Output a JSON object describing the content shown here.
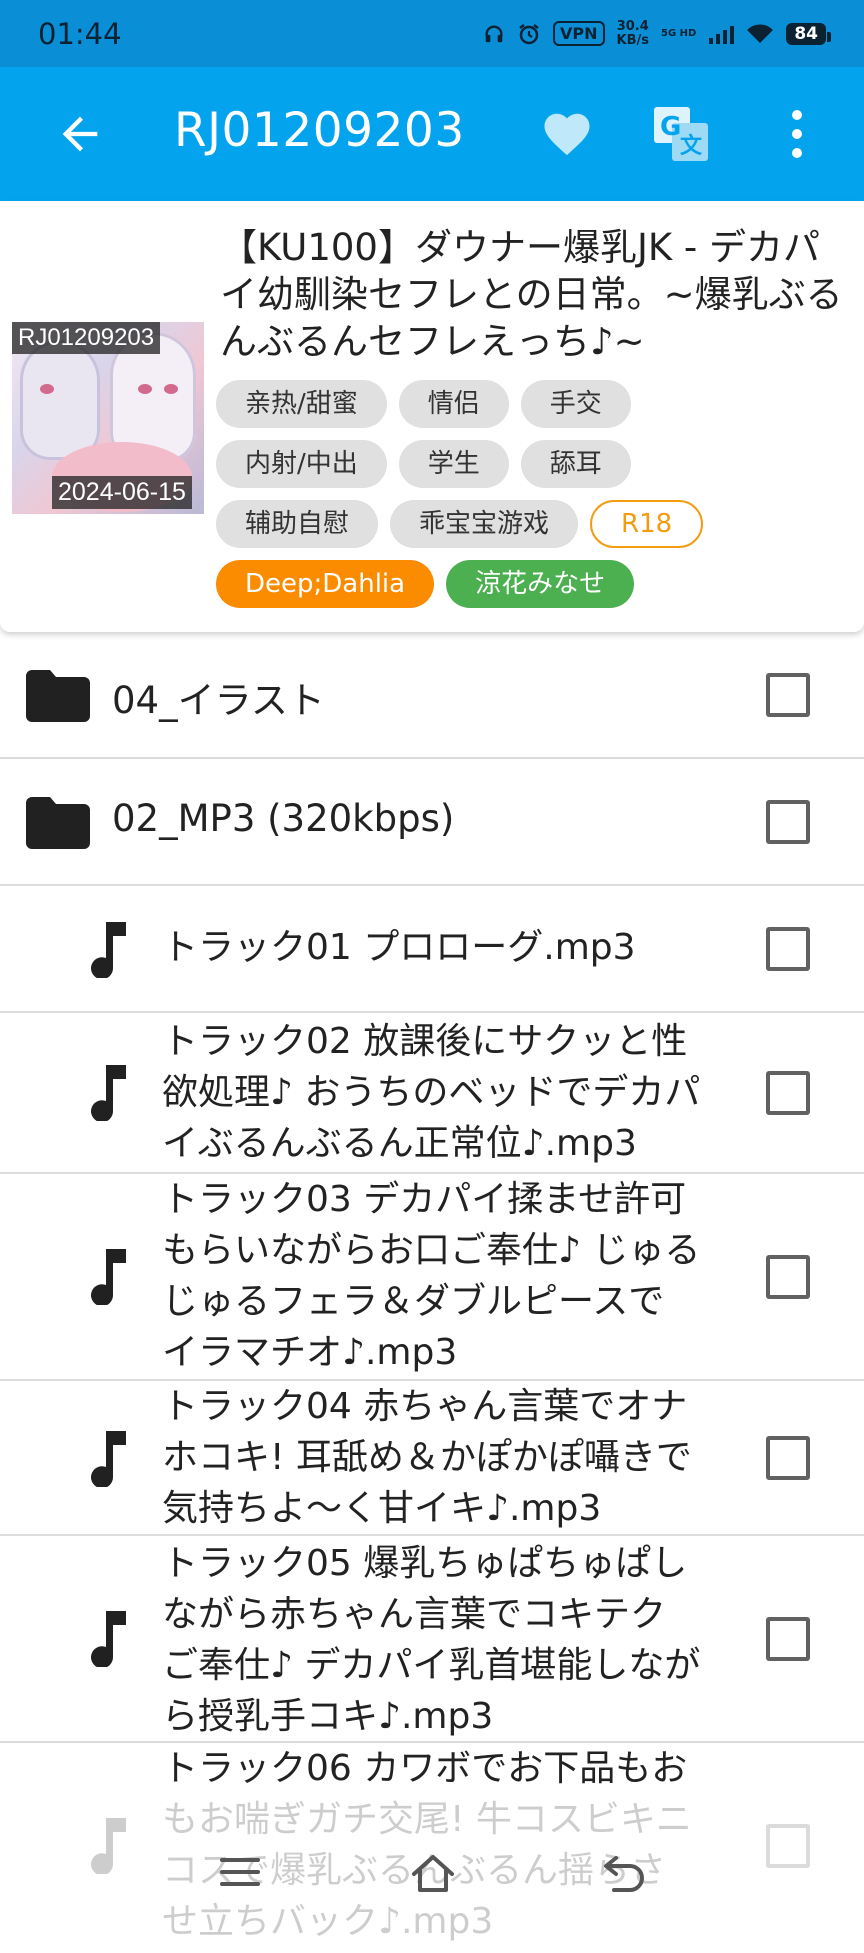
{
  "status_bar": {
    "time": "01:44",
    "vpn": "VPN",
    "net_speed_value": "30.4",
    "net_speed_unit": "KB/s",
    "network": "5G HD",
    "battery": "84"
  },
  "app_bar": {
    "title": "RJ01209203",
    "icons": [
      "back-arrow-icon",
      "heart-icon",
      "translate-icon",
      "more-vert-icon"
    ]
  },
  "work": {
    "cover_id": "RJ01209203",
    "release_date": "2024-06-15",
    "title": "【KU100】ダウナー爆乳JK - デカパイ幼馴染セフレとの日常。~爆乳ぶるんぶるんセフレえっち♪~",
    "tag_rows": [
      [
        "亲热/甜蜜",
        "情侣",
        "手交"
      ],
      [
        "内射/中出",
        "学生",
        "舔耳"
      ],
      [
        "辅助自慰",
        "乖宝宝游戏"
      ]
    ],
    "age_rating": "R18",
    "circle": "Deep;Dahlia",
    "voice_actor": "涼花みなせ",
    "colors": {
      "circle": "#fb8c00",
      "voice_actor": "#4caf50",
      "r18": "#f39c12",
      "app_bar": "#03a4ed"
    }
  },
  "files": {
    "folders": [
      {
        "name": "04_イラスト",
        "icon": "folder-icon"
      },
      {
        "name": "02_MP3 (320kbps)",
        "icon": "folder-icon"
      }
    ],
    "tracks": [
      {
        "icon": "music-note-icon",
        "lines": [
          "トラック01 プロローグ.mp3"
        ]
      },
      {
        "icon": "music-note-icon",
        "lines": [
          "トラック02 放課後にサクッと性",
          "欲処理♪ おうちのベッドでデカパ",
          "イぶるんぶるん正常位♪.mp3"
        ]
      },
      {
        "icon": "music-note-icon",
        "lines": [
          "トラック03 デカパイ揉ませ許可",
          "もらいながらお口ご奉仕♪ じゅる",
          "じゅるフェラ＆ダブルピースで",
          "イラマチオ♪.mp3"
        ]
      },
      {
        "icon": "music-note-icon",
        "lines": [
          "トラック04 赤ちゃん言葉でオナ",
          "ホコキ! 耳舐め＆かぽかぽ囁きで",
          "気持ちよ～く甘イキ♪.mp3"
        ]
      },
      {
        "icon": "music-note-icon",
        "lines": [
          "トラック05 爆乳ちゅぱちゅぱし",
          "ながら赤ちゃん言葉でコキテク",
          "ご奉仕♪ デカパイ乳首堪能しなが",
          "ら授乳手コキ♪.mp3"
        ]
      },
      {
        "icon": "music-note-icon",
        "lines": [
          "トラック06 カワボでお下品もお",
          "もお喘ぎガチ交尾! 牛コスビキニ",
          "コスで爆乳ぶるんぶるん揺らさ",
          "せ立ちバック♪.mp3"
        ]
      }
    ]
  },
  "nav_bar": {
    "icons": [
      "menu-icon",
      "home-icon",
      "back-icon"
    ]
  }
}
